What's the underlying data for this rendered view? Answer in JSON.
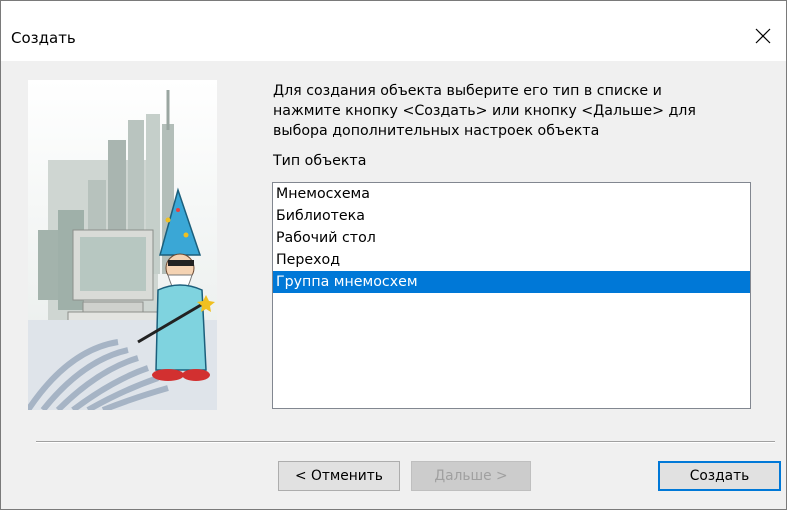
{
  "window": {
    "title": "Создать"
  },
  "description": [
    "Для создания объекта выберите его тип в списке и",
    "нажмите кнопку <Создать> или кнопку <Дальше> для",
    "выбора дополнительных настроек объекта"
  ],
  "list_label": "Тип объекта",
  "object_types": [
    {
      "label": "Мнемосхема",
      "selected": false
    },
    {
      "label": "Библиотека",
      "selected": false
    },
    {
      "label": "Рабочий стол",
      "selected": false
    },
    {
      "label": "Переход",
      "selected": false
    },
    {
      "label": "Группа мнемосхем",
      "selected": true
    }
  ],
  "buttons": {
    "cancel": "< Отменить",
    "next": "Дальше >",
    "create": "Создать"
  },
  "icons": {
    "close": "close-icon",
    "illustration": "wizard-illustration"
  },
  "colors": {
    "selection": "#0078d7",
    "default_button_border": "#0078d7",
    "dialog_bg": "#f0f0f0"
  }
}
